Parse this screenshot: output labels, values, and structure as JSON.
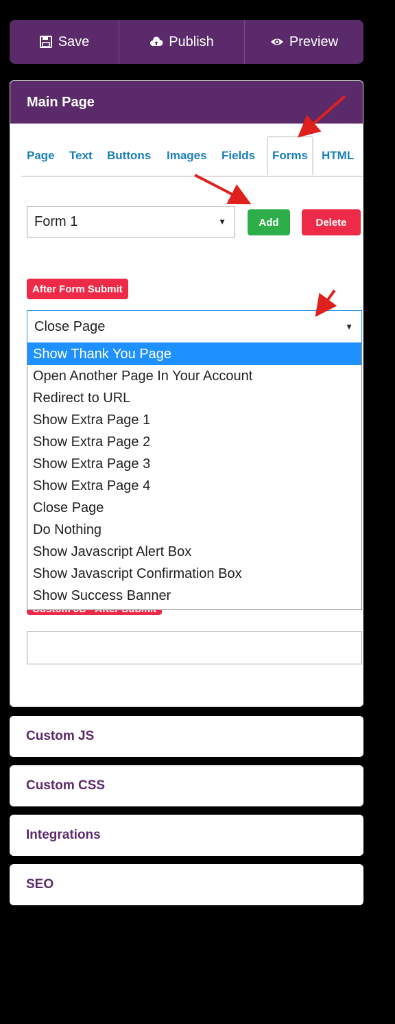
{
  "toolbar": {
    "save_label": "Save",
    "publish_label": "Publish",
    "preview_label": "Preview"
  },
  "main_panel": {
    "title": "Main Page",
    "tabs": [
      {
        "label": "Page"
      },
      {
        "label": "Text"
      },
      {
        "label": "Buttons"
      },
      {
        "label": "Images"
      },
      {
        "label": "Fields"
      },
      {
        "label": "Forms",
        "active": true
      },
      {
        "label": "HTML"
      }
    ],
    "form_select_value": "Form 1",
    "add_label": "Add",
    "delete_label": "Delete",
    "after_submit_label": "After Form Submit",
    "after_submit_value": "Close Page",
    "after_submit_options": [
      "Show Thank You Page",
      "Open Another Page In Your Account",
      "Redirect to URL",
      "Show Extra Page 1",
      "Show Extra Page 2",
      "Show Extra Page 3",
      "Show Extra Page 4",
      "Close Page",
      "Do Nothing",
      "Show Javascript Alert Box",
      "Show Javascript Confirmation Box",
      "Show Success Banner"
    ],
    "highlighted_option": "Show Thank You Page",
    "custom_js_label": "Custom JS - After Submit"
  },
  "sections": {
    "custom_js": "Custom JS",
    "custom_css": "Custom CSS",
    "integrations": "Integrations",
    "seo": "SEO"
  },
  "colors": {
    "brand_purple": "#5b2a6a",
    "tab_blue": "#1a7fb8",
    "add_green": "#2eae4a",
    "danger_red": "#ee2a49",
    "highlight_blue": "#1e90ff",
    "annotation_arrow": "#e0201c"
  }
}
